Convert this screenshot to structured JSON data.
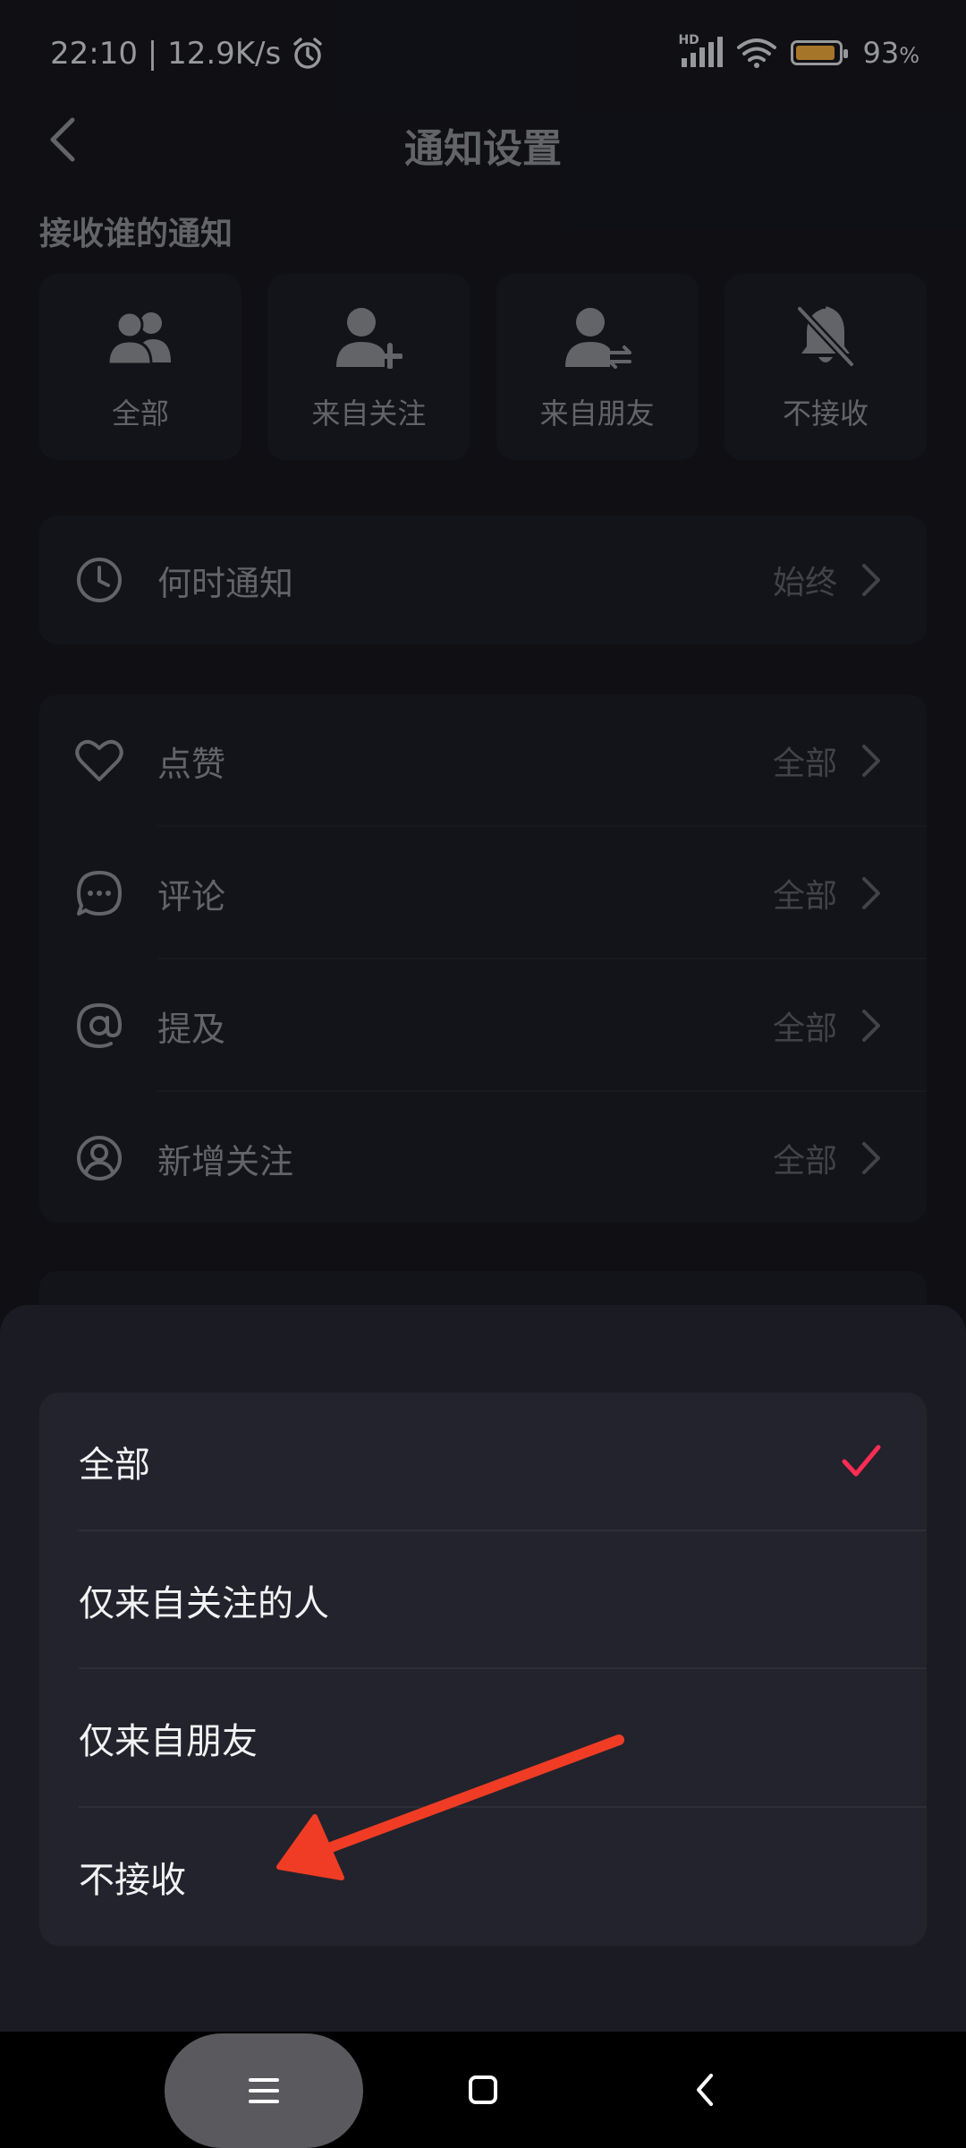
{
  "status_bar": {
    "time": "22:10",
    "network_speed": "12.9K/s",
    "signal_badge": "HD",
    "battery_percent": 93,
    "battery_label": "93",
    "battery_unit": "%",
    "battery_color": "#e5a23a"
  },
  "header": {
    "title": "通知设置"
  },
  "who_section": {
    "label": "接收谁的通知",
    "options": [
      {
        "label": "全部",
        "icon": "group-icon"
      },
      {
        "label": "来自关注",
        "icon": "person-add-icon"
      },
      {
        "label": "来自朋友",
        "icon": "person-swap-icon"
      },
      {
        "label": "不接收",
        "icon": "bell-off-icon"
      }
    ]
  },
  "when_row": {
    "label": "何时通知",
    "value": "始终",
    "icon": "clock-icon"
  },
  "types": [
    {
      "label": "点赞",
      "value": "全部",
      "icon": "heart-icon"
    },
    {
      "label": "评论",
      "value": "全部",
      "icon": "comment-icon"
    },
    {
      "label": "提及",
      "value": "全部",
      "icon": "at-icon"
    },
    {
      "label": "新增关注",
      "value": "全部",
      "icon": "user-circle-icon"
    }
  ],
  "sheet": {
    "options": [
      {
        "label": "全部",
        "selected": true
      },
      {
        "label": "仅来自关注的人",
        "selected": false
      },
      {
        "label": "仅来自朋友",
        "selected": false
      },
      {
        "label": "不接收",
        "selected": false
      }
    ],
    "check_color": "#fe2c55"
  },
  "annotation": {
    "arrow_color": "#f03c24"
  }
}
